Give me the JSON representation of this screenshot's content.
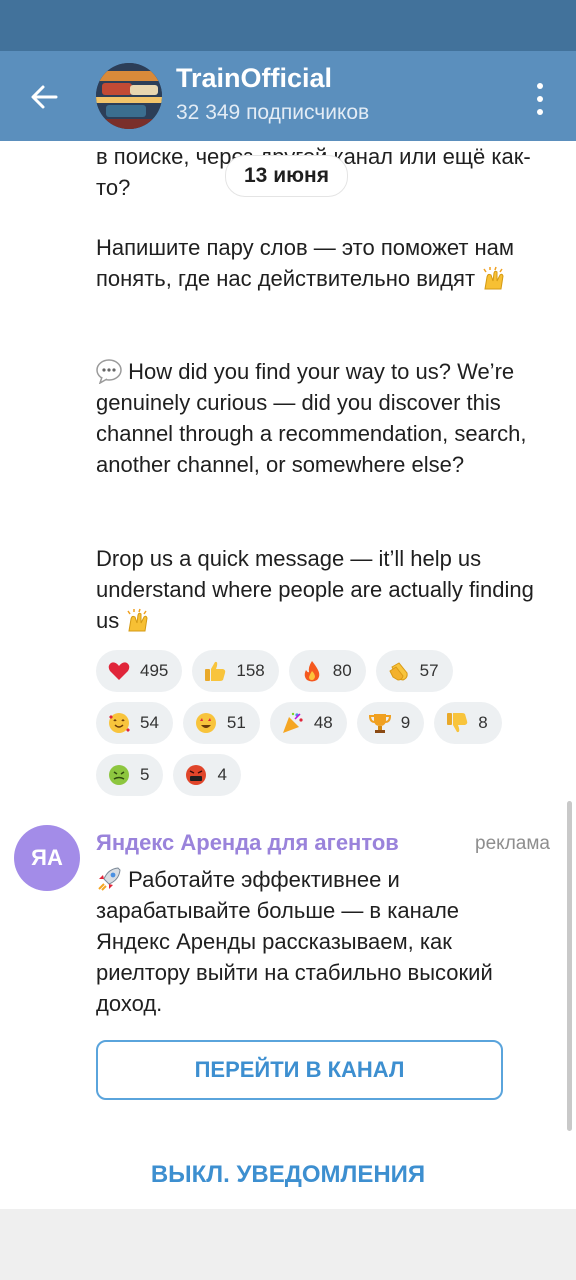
{
  "header": {
    "title": "TrainOfficial",
    "subtitle": "32 349 подписчиков"
  },
  "post": {
    "date": "13 июня",
    "text_ru_tail": "в поиске, через другой канал или ещё как-то?",
    "text_ru_2": "Напишите пару слов — это поможет нам понять, где нас действительно видят",
    "text_en_1": "How did you find your way to us? We’re genuinely curious — did you discover this channel through a recommendation, search, another channel, or somewhere else?",
    "text_en_2": "Drop us a quick message — it’ll help us understand where people are actually finding us"
  },
  "reactions": [
    {
      "icon": "heart-icon",
      "count": "495"
    },
    {
      "icon": "thumbs-up-icon",
      "count": "158"
    },
    {
      "icon": "fire-icon",
      "count": "80"
    },
    {
      "icon": "clapping-icon",
      "count": "57"
    },
    {
      "icon": "smiling-hearts-icon",
      "count": "54"
    },
    {
      "icon": "star-struck-icon",
      "count": "51"
    },
    {
      "icon": "party-popper-icon",
      "count": "48"
    },
    {
      "icon": "trophy-icon",
      "count": "9"
    },
    {
      "icon": "thumbs-down-icon",
      "count": "8"
    },
    {
      "icon": "nauseated-face-icon",
      "count": "5"
    },
    {
      "icon": "cursing-face-icon",
      "count": "4"
    }
  ],
  "ad": {
    "avatar_initials": "ЯА",
    "name": "Яндекс Аренда для агентов",
    "label": "реклама",
    "text": "Работайте эффективнее и зарабатывайте больше — в канале Яндекс Аренды рассказываем, как риелтору выйти на стабильно высокий доход.",
    "button": "ПЕРЕЙТИ В КАНАЛ"
  },
  "bottom_action": "ВЫКЛ. УВЕДОМЛЕНИЯ",
  "colors": {
    "header": "#5b8fbd",
    "status_bar": "#42729b",
    "accent": "#3d8fd0",
    "ad_name": "#9a83db",
    "reaction_bg": "#edf0f2"
  }
}
